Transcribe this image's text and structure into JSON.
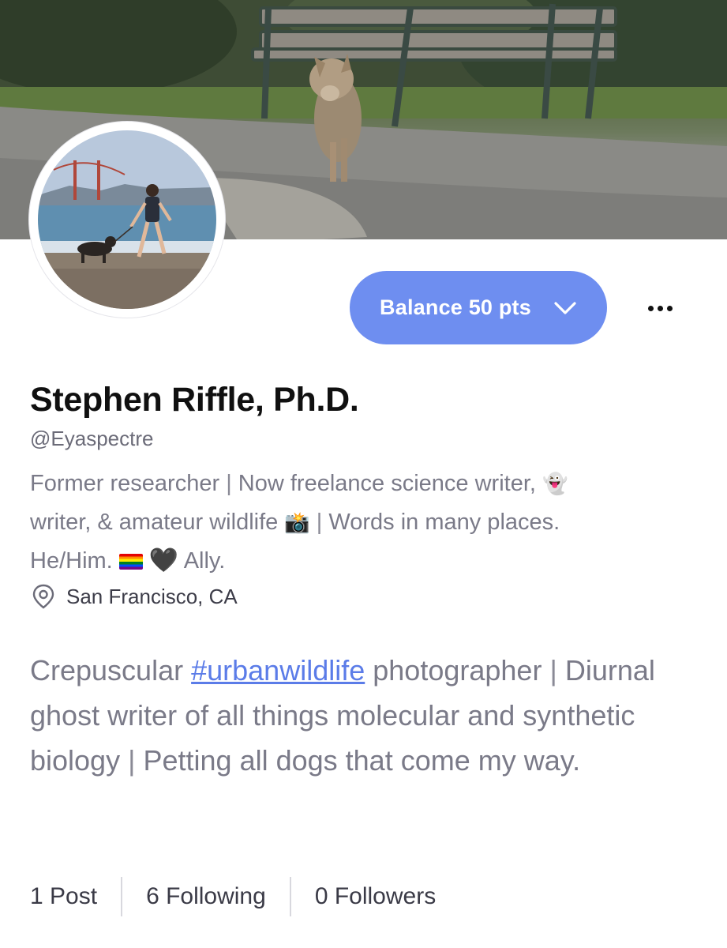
{
  "profile": {
    "name": "Stephen Riffle, Ph.D.",
    "handle": "@Eyaspectre",
    "bio": {
      "part1": "Former researcher",
      "part2": "Now freelance science writer,",
      "ghost_emoji": "👻",
      "part3": "writer, & amateur wildlife",
      "camera_emoji": "📸",
      "part4": "Words in many places.",
      "part5": "He/Him.",
      "heart_emoji": "🖤",
      "part6": "Ally."
    },
    "location": "San Francisco, CA",
    "about": {
      "text1": "Crepuscular",
      "hashtag": "#urbanwildlife",
      "text2": "photographer",
      "text3": "Diurnal ghost writer of all things molecular and synthetic biology",
      "text4": "Petting all dogs that come my way."
    }
  },
  "actions": {
    "balance_label": "Balance 50 pts"
  },
  "stats": {
    "posts": "1 Post",
    "following": "6 Following",
    "followers": "0 Followers"
  },
  "colors": {
    "accent": "#6e8ef0",
    "hashtag": "#5b7ce8",
    "muted_text": "#7a7a88"
  },
  "icons": {
    "more": "more-dots-icon",
    "location": "location-pin-icon",
    "chevron": "chevron-down-icon"
  }
}
